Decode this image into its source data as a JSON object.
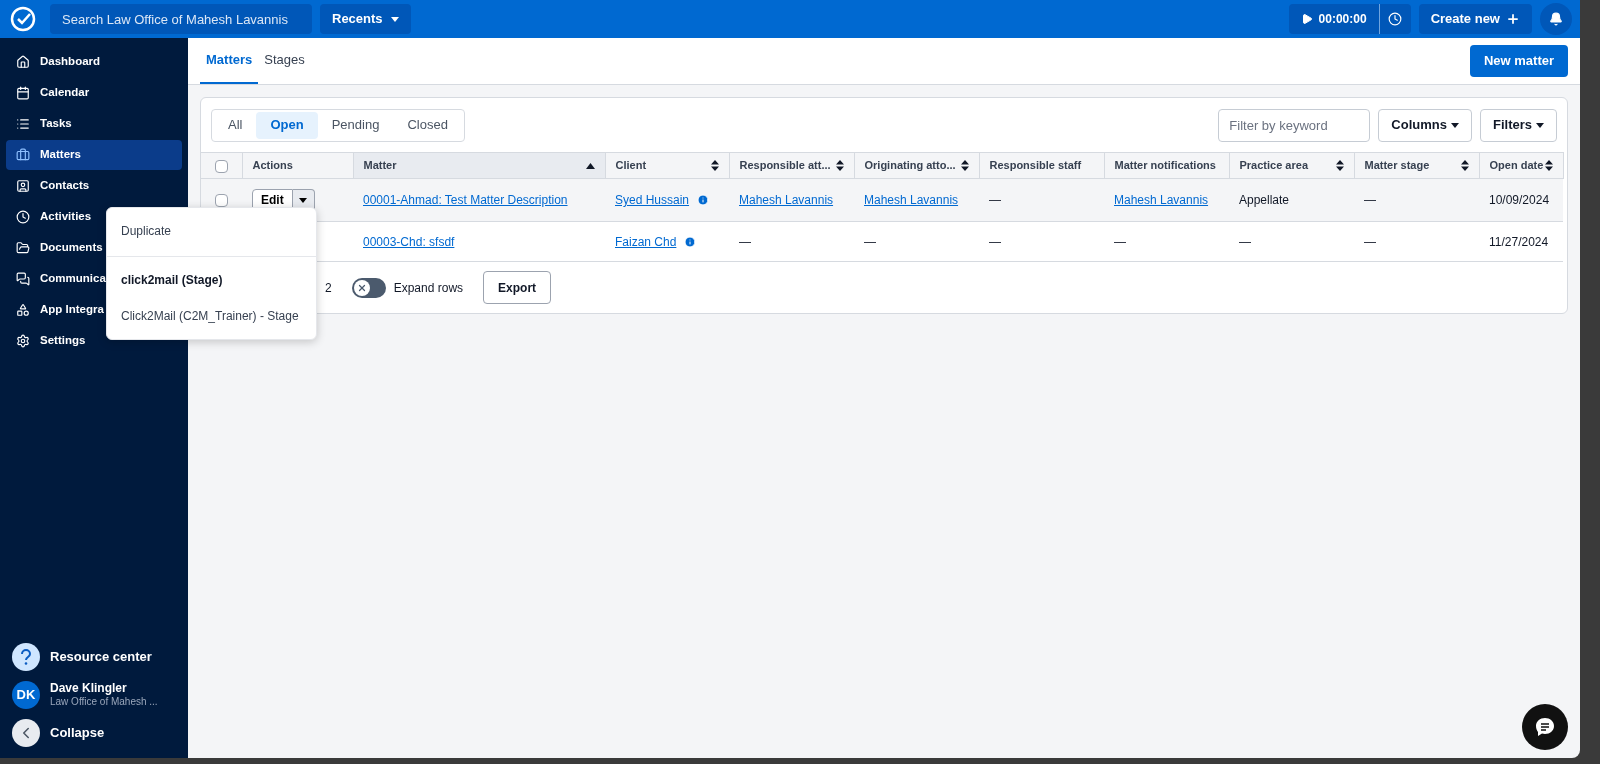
{
  "topbar": {
    "search_placeholder": "Search Law Office of Mahesh Lavannis",
    "recents": "Recents",
    "timer": "00:00:00",
    "create_new": "Create new"
  },
  "sidebar": {
    "items": [
      {
        "label": "Dashboard",
        "selected": false
      },
      {
        "label": "Calendar",
        "selected": false
      },
      {
        "label": "Tasks",
        "selected": false
      },
      {
        "label": "Matters",
        "selected": true
      },
      {
        "label": "Contacts",
        "selected": false
      },
      {
        "label": "Activities",
        "selected": false
      },
      {
        "label": "Documents",
        "selected": false
      },
      {
        "label": "Communica",
        "selected": false
      },
      {
        "label": "App Integra",
        "selected": false
      },
      {
        "label": "Settings",
        "selected": false
      }
    ],
    "resource_center": "Resource center",
    "user": {
      "initials": "DK",
      "name": "Dave Klingler",
      "firm": "Law Office of Mahesh ..."
    },
    "collapse": "Collapse"
  },
  "page_tabs": [
    {
      "label": "Matters",
      "selected": true
    },
    {
      "label": "Stages",
      "selected": false
    }
  ],
  "new_matter": "New matter",
  "status_filters": [
    {
      "label": "All",
      "selected": false
    },
    {
      "label": "Open",
      "selected": true
    },
    {
      "label": "Pending",
      "selected": false
    },
    {
      "label": "Closed",
      "selected": false
    }
  ],
  "keyword_filter": {
    "placeholder": "Filter by keyword"
  },
  "columns_button": "Columns",
  "filters_button": "Filters",
  "table": {
    "columns": [
      {
        "kind": "checkbox",
        "checked": false
      },
      {
        "kind": "label",
        "label": "Actions",
        "sortable": false,
        "sorted": false
      },
      {
        "kind": "label",
        "label": "Matter",
        "sortable": true,
        "sorted": true
      },
      {
        "kind": "label",
        "label": "Client",
        "sortable": true,
        "sorted": false
      },
      {
        "kind": "label",
        "label": "Responsible att...",
        "sortable": true,
        "sorted": false
      },
      {
        "kind": "label",
        "label": "Originating atto...",
        "sortable": true,
        "sorted": false
      },
      {
        "kind": "label",
        "label": "Responsible staff",
        "sortable": false,
        "sorted": false
      },
      {
        "kind": "label",
        "label": "Matter notifications",
        "sortable": false,
        "sorted": false
      },
      {
        "kind": "label",
        "label": "Practice area",
        "sortable": true,
        "sorted": false
      },
      {
        "kind": "label",
        "label": "Matter stage",
        "sortable": true,
        "sorted": false
      },
      {
        "kind": "label",
        "label": "Open date",
        "sortable": true,
        "sorted": false
      }
    ],
    "rows": [
      {
        "cells": [
          {
            "kind": "checkbox",
            "checked": false
          },
          {
            "kind": "edit",
            "text": "Edit"
          },
          {
            "kind": "link",
            "text": "00001-Ahmad: Test Matter Description"
          },
          {
            "kind": "client",
            "text": "Syed Hussain"
          },
          {
            "kind": "link",
            "text": "Mahesh Lavannis"
          },
          {
            "kind": "link",
            "text": "Mahesh Lavannis"
          },
          {
            "kind": "text",
            "text": "—"
          },
          {
            "kind": "link",
            "text": "Mahesh Lavannis"
          },
          {
            "kind": "text",
            "text": "Appellate"
          },
          {
            "kind": "text",
            "text": "—"
          },
          {
            "kind": "text",
            "text": "10/09/2024"
          }
        ]
      },
      {
        "cells": [
          {
            "kind": "empty"
          },
          {
            "kind": "empty"
          },
          {
            "kind": "link",
            "text": "00003-Chd: sfsdf"
          },
          {
            "kind": "client",
            "text": "Faizan Chd"
          },
          {
            "kind": "text",
            "text": "—"
          },
          {
            "kind": "text",
            "text": "—"
          },
          {
            "kind": "text",
            "text": "—"
          },
          {
            "kind": "text",
            "text": "—"
          },
          {
            "kind": "text",
            "text": "—"
          },
          {
            "kind": "text",
            "text": "—"
          },
          {
            "kind": "text",
            "text": "11/27/2024"
          }
        ]
      }
    ]
  },
  "footer": {
    "count": "2",
    "expand_rows": {
      "label": "Expand rows",
      "on": false
    },
    "export": "Export"
  },
  "actions_menu": [
    {
      "kind": "item",
      "text": "Duplicate"
    },
    {
      "kind": "divider"
    },
    {
      "kind": "heading",
      "text": "click2mail (Stage)"
    },
    {
      "kind": "item",
      "text": "Click2Mail (C2M_Trainer) - Stage"
    }
  ]
}
